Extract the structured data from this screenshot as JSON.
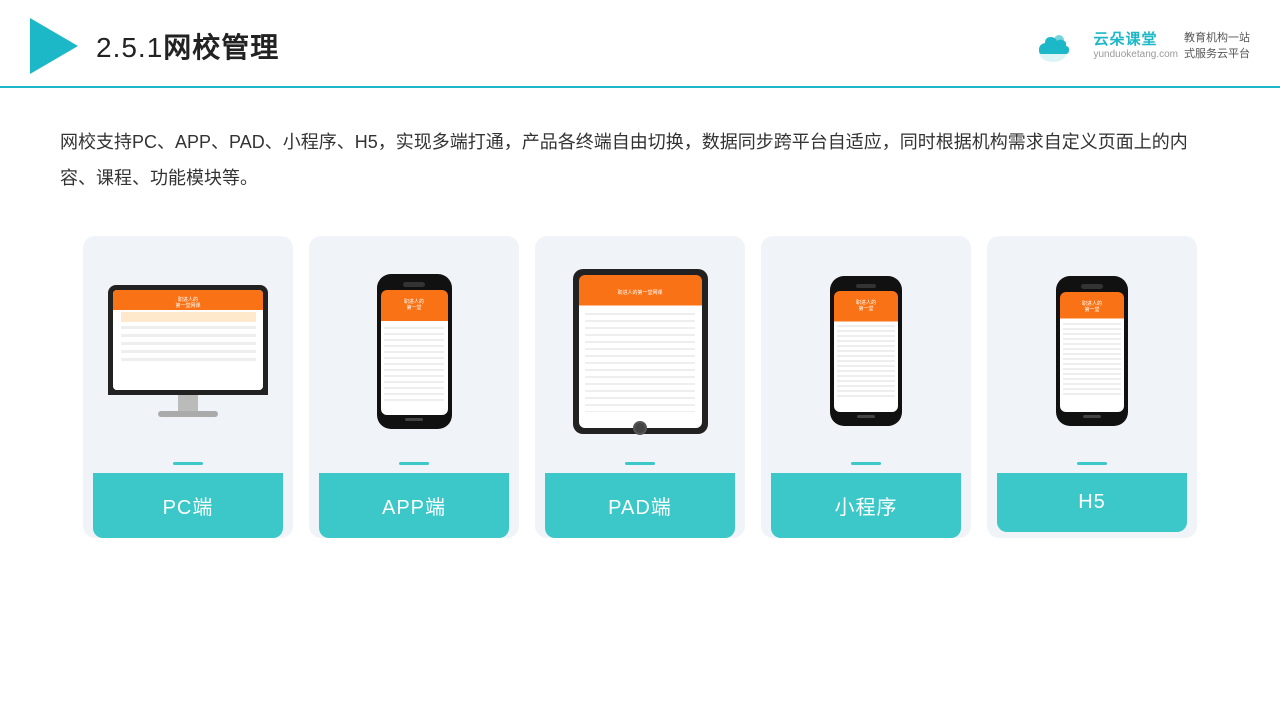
{
  "header": {
    "page_number": "2.5.1",
    "title": "网校管理",
    "brand": {
      "name": "云朵课堂",
      "url": "yunduoketang.com",
      "slogan": "教育机构一站\n式服务云平台"
    }
  },
  "description": {
    "text": "网校支持PC、APP、PAD、小程序、H5，实现多端打通，产品各终端自由切换，数据同步跨平台自适应，同时根据机构需求自定义页面上的内容、课程、功能模块等。"
  },
  "cards": [
    {
      "id": "pc",
      "label": "PC端"
    },
    {
      "id": "app",
      "label": "APP端"
    },
    {
      "id": "pad",
      "label": "PAD端"
    },
    {
      "id": "miniprogram",
      "label": "小程序"
    },
    {
      "id": "h5",
      "label": "H5"
    }
  ],
  "colors": {
    "accent": "#1db8c8",
    "teal": "#3cc8c8",
    "orange": "#f97316",
    "card_bg": "#f0f4f8"
  }
}
